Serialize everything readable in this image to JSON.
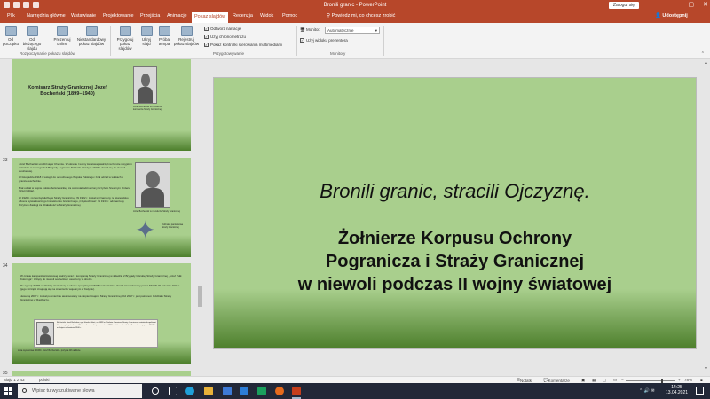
{
  "titlebar": {
    "title": "Bronili granic - PowerPoint",
    "signin": "Zaloguj się",
    "window_buttons": [
      "—",
      "▢",
      "✕"
    ]
  },
  "tabs": {
    "items": [
      "Plik",
      "Narzędzia główne",
      "Wstawianie",
      "Projektowanie",
      "Przejścia",
      "Animacje",
      "Pokaz slajdów",
      "Recenzja",
      "Widok",
      "Pomoc"
    ],
    "active": "Pokaz slajdów",
    "tell_me": "Powiedz mi, co chcesz zrobić",
    "share": "Udostępnij"
  },
  "ribbon": {
    "start_group": {
      "label": "Rozpoczynanie pokazu slajdów",
      "buttons": [
        "Od początku",
        "Od bieżącego slajdu",
        "Prezentuj online",
        "Niestandardowy pokaz slajdów"
      ]
    },
    "setup_group": {
      "label": "Przygotowywanie",
      "buttons": [
        "Przygotuj pokaz slajdów",
        "Ukryj slajd",
        "Próba tempa",
        "Rejestruj pokaz slajdów"
      ],
      "checks": [
        {
          "label": "Odtwórz narracje",
          "checked": true
        },
        {
          "label": "Użyj chronometrażu",
          "checked": true
        },
        {
          "label": "Pokaż kontrolki sterowania multimediami",
          "checked": true
        }
      ]
    },
    "monitors_group": {
      "label": "Monitory",
      "monitor_label": "Monitor:",
      "monitor_value": "Automatycznie",
      "presenter_view": "Użyj widoku prezentera"
    }
  },
  "thumbnails": {
    "slides": [
      {
        "number": "",
        "title": "Komisarz Straży Granicznej Józef Bocheński (1899–1940)",
        "caption": "Józef Bocheński w mundurze komisarza Straży Granicznej"
      },
      {
        "number": "33",
        "text": "Józef Bocheński urodził się w Chełmie. W okresie I wojny światowej walczył na froncie rosyjskim i włoskim w szeregach II Brygady Legionów Polskich. W lutym 1918 r. dostał się do niewoli austriackiej.\n\nW listopadzie 1918 r. wstąpił do odrodzonego Wojska Polskiego i brał udział w walkach o granice wschodnie.\n\nBrał udział w wojnie polsko-bolszewickiej, za co został odznaczony Krzyżem Srebrnym Orderu Virtuti Militari.\n\nW 1920 r. rozpoczął służbę w Straży Granicznej. W 1922 r. został wyznaczony na stanowisko oficera wywiadowczego Inspektoratu Granicznego „Częstochowa”. W 1939 r. odznaczony Krzyżem Zasługi za działalność w Straży Granicznej.",
        "caption1": "Józef Bocheński w mundurze Straży Granicznej",
        "caption2": "Odznaka pamiątkowa Straży Granicznej"
      },
      {
        "number": "34",
        "text": "W czasie kampanii wrześniowej walczył wraz z kompanią Straży Granicznej w składzie 2 Brygady Górskiej Straży Granicznej „Józef Pułk Kołomyja”. Wzięty do niewoli sowieckiej i osadzony w obozie.\n\nPo agresji ZSRR na Polskę znalazł się w obozie specjalnym NKWD w Kozielsku. Został zamordowany przez NKWD 20 kwietnia 1940 r. (jego szczątki znajdują się na cmentarzu wojennym w Katyniu).\n\nJesienią 2007 r. został pośmiertnie awansowany na stopień majora Straży Granicznej. Od 2017 r. jest patronem Oddziału Straży Granicznej w Raciborzu.",
        "caption": "Lista wywozowa NKWD. Józef Bocheński – pozycja 48 na liście.",
        "doc_text": "Bocheński Józef Bolesław, syn Józefa i Marii, ur. 1899 w Chełmie. Komisarz Straży Granicznej, ostatnio Inspektorat Graniczny Częstochowa. W niewoli sowieckiej od września 1939 r., obóz w Kozielsku. Zamordowany przez NKWD w Katyniu w kwietniu 1940 r."
      },
      {
        "number": "35"
      }
    ]
  },
  "main_slide": {
    "title": "Bronili granic, stracili Ojczyznę.",
    "subtitle_lines": [
      "Żołnierze Korpusu Ochrony",
      "Pogranicza i Straży Granicznej",
      "w niewoli podczas II wojny światowej"
    ]
  },
  "statusbar": {
    "slide_info": "Slajd 1 z 43",
    "language": "polski",
    "notes": "Notatki",
    "comments": "Komentarze",
    "zoom": "78%"
  },
  "taskbar": {
    "search_placeholder": "Wpisz tu wyszukiwane słowa",
    "time": "14:25",
    "date": "13.04.2021"
  },
  "colors": {
    "accent": "#b7472a",
    "slide_bg": "#a9cf8d",
    "slide_dark": "#4d7f2c"
  }
}
